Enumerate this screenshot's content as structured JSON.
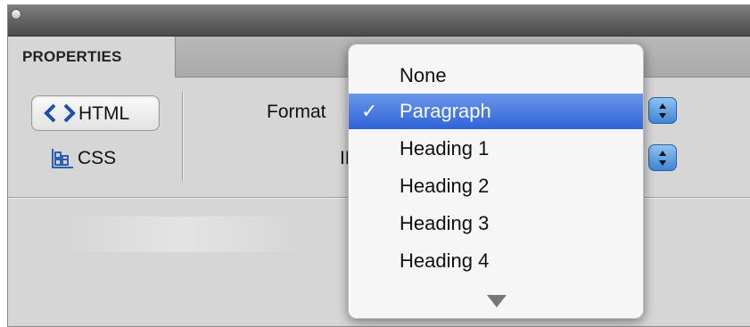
{
  "panel": {
    "tab_label": "PROPERTIES",
    "html_label": "HTML",
    "css_label": "CSS",
    "format_label": "Format",
    "id_label": "ID"
  },
  "format_menu": {
    "items": [
      {
        "label": "None",
        "selected": false
      },
      {
        "label": "Paragraph",
        "selected": true
      },
      {
        "label": "Heading 1",
        "selected": false
      },
      {
        "label": "Heading 2",
        "selected": false
      },
      {
        "label": "Heading 3",
        "selected": false
      },
      {
        "label": "Heading 4",
        "selected": false
      }
    ],
    "check_mark": "✓",
    "scroll_indicator": "scroll-down-arrow-icon"
  },
  "colors": {
    "selection_highlight": "#3f73dd",
    "stepper": "#5aa0e8"
  }
}
